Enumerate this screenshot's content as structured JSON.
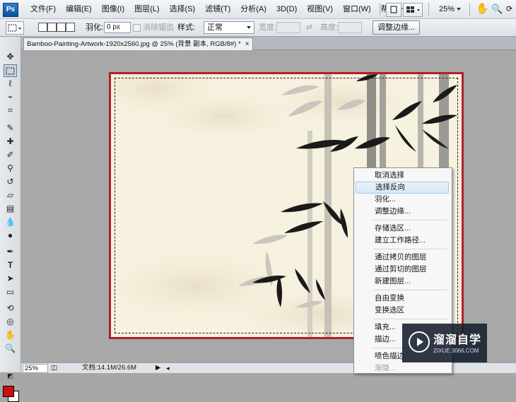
{
  "app": {
    "logo": "Ps"
  },
  "menubar": {
    "items": [
      "文件(F)",
      "编辑(E)",
      "图像(I)",
      "图层(L)",
      "选择(S)",
      "滤镜(T)",
      "分析(A)",
      "3D(D)",
      "视图(V)",
      "窗口(W)",
      "帮助(H)"
    ],
    "zoom": "25%"
  },
  "options": {
    "feather_label": "羽化:",
    "feather_value": "0 px",
    "antialias_label": "消除锯齿",
    "style_label": "样式:",
    "style_value": "正常",
    "width_label": "宽度:",
    "height_label": "高度:",
    "refine_button": "调整边缘..."
  },
  "document": {
    "tab_title": "Bamboo-Painting-Artwork-1920x2560.jpg @ 25% (背景 副本, RGB/8#) *",
    "close_label": "×"
  },
  "statusbar": {
    "zoom": "25%",
    "doc_info": "文档:14.1M/26.6M"
  },
  "colors": {
    "foreground": "#c80f0f",
    "background": "#ffffff",
    "canvas_border": "#b3202a"
  },
  "context_menu": {
    "items": [
      {
        "label": "取消选择",
        "state": "normal"
      },
      {
        "label": "选择反向",
        "state": "hover"
      },
      {
        "label": "羽化...",
        "state": "normal"
      },
      {
        "label": "调整边缘...",
        "state": "normal"
      },
      {
        "label": "存储选区...",
        "state": "normal"
      },
      {
        "label": "建立工作路径...",
        "state": "normal"
      },
      {
        "label": "通过拷贝的图层",
        "state": "normal"
      },
      {
        "label": "通过剪切的图层",
        "state": "normal"
      },
      {
        "label": "新建图层...",
        "state": "normal"
      },
      {
        "label": "自由变换",
        "state": "normal"
      },
      {
        "label": "变换选区",
        "state": "normal"
      },
      {
        "label": "填充...",
        "state": "normal"
      },
      {
        "label": "描边...",
        "state": "normal"
      },
      {
        "label": "喷色描边",
        "state": "normal"
      },
      {
        "label": "渐隐...",
        "state": "disabled"
      }
    ]
  },
  "watermark": {
    "title": "溜溜自学",
    "subtitle": "ZIXUE.3066.COM"
  }
}
